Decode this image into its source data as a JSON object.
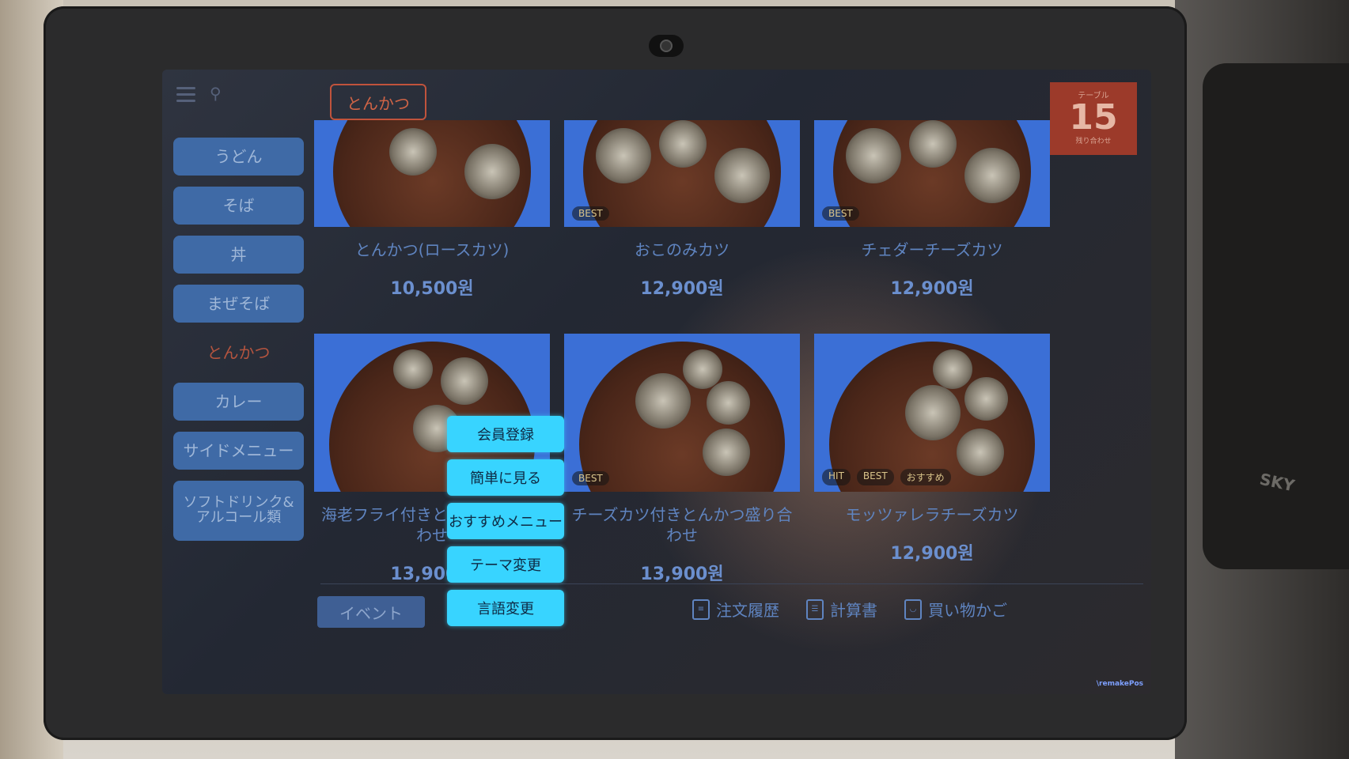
{
  "app": {
    "theme_accent": "#38d4ff"
  },
  "header": {
    "category_tag": "とんかつ"
  },
  "table": {
    "label": "テーブル",
    "number": "15",
    "sub": "残り合わせ"
  },
  "sidebar": {
    "items": [
      {
        "label": "うどん",
        "active": false
      },
      {
        "label": "そば",
        "active": false
      },
      {
        "label": "丼",
        "active": false
      },
      {
        "label": "まぜそば",
        "active": false
      },
      {
        "label": "とんかつ",
        "active": true
      },
      {
        "label": "カレー",
        "active": false
      },
      {
        "label": "サイドメニュー",
        "active": false
      },
      {
        "label": "ソフトドリンク&アルコール類",
        "active": false
      }
    ]
  },
  "products": [
    {
      "name": "とんかつ(ロースカツ)",
      "price": "10,500원",
      "badges": []
    },
    {
      "name": "おこのみカツ",
      "price": "12,900원",
      "badges": [
        "BEST"
      ]
    },
    {
      "name": "チェダーチーズカツ",
      "price": "12,900원",
      "badges": [
        "BEST"
      ]
    },
    {
      "name": "海老フライ付きとんかつ盛り合わせ",
      "price": "13,900원",
      "badges": []
    },
    {
      "name": "チーズカツ付きとんかつ盛り合わせ",
      "price": "13,900원",
      "badges": [
        "BEST"
      ]
    },
    {
      "name": "モッツァレラチーズカツ",
      "price": "12,900원",
      "badges": [
        "HIT",
        "BEST",
        "おすすめ"
      ]
    }
  ],
  "event_button": "イベント",
  "popup_menu": {
    "items": [
      "会員登録",
      "簡単に見る",
      "おすすめメニュー",
      "テーマ変更",
      "言語変更"
    ]
  },
  "bottom_bar": {
    "order_history": "注文履歴",
    "bill": "計算書",
    "cart": "買い物かご"
  },
  "footer": {
    "logo": "\\remakePos"
  },
  "device": {
    "brand": "SKY"
  }
}
